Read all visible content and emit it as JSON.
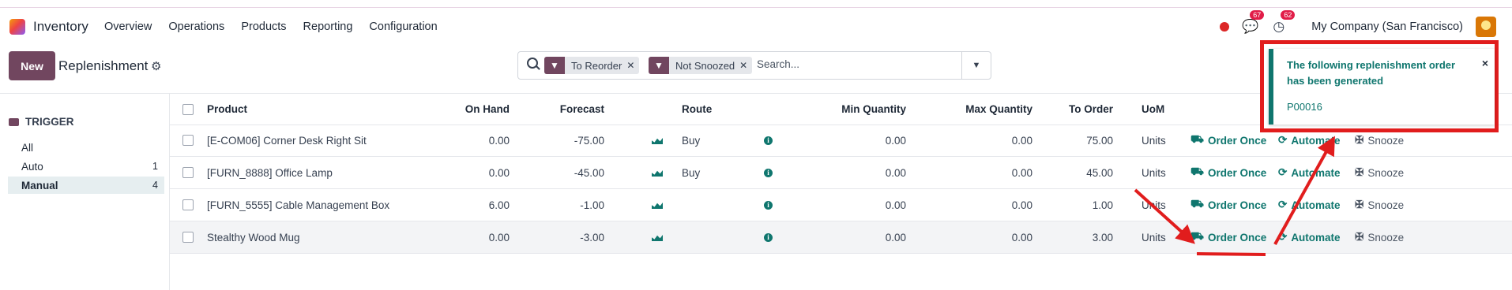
{
  "app": {
    "name": "Inventory"
  },
  "nav": {
    "menu": [
      "Overview",
      "Operations",
      "Products",
      "Reporting",
      "Configuration"
    ],
    "messages_count": "67",
    "activities_count": "62",
    "company": "My Company (San Francisco)"
  },
  "controls": {
    "new_label": "New",
    "page_title": "Replenishment"
  },
  "search": {
    "facets": [
      {
        "label": "To Reorder"
      },
      {
        "label": "Not Snoozed"
      }
    ],
    "placeholder": "Search..."
  },
  "sidepanel": {
    "title": "TRIGGER",
    "items": [
      {
        "label": "All",
        "count": ""
      },
      {
        "label": "Auto",
        "count": "1"
      },
      {
        "label": "Manual",
        "count": "4"
      }
    ]
  },
  "table": {
    "headers": {
      "product": "Product",
      "on_hand": "On Hand",
      "forecast": "Forecast",
      "route": "Route",
      "min_qty": "Min Quantity",
      "max_qty": "Max Quantity",
      "to_order": "To Order",
      "uom": "UoM"
    },
    "actions": {
      "order_once": "Order Once",
      "automate": "Automate",
      "snooze": "Snooze"
    },
    "rows": [
      {
        "product": "[E-COM06] Corner Desk Right Sit",
        "on_hand": "0.00",
        "forecast": "-75.00",
        "route": "Buy",
        "min_qty": "0.00",
        "max_qty": "0.00",
        "to_order": "75.00",
        "uom": "Units"
      },
      {
        "product": "[FURN_8888] Office Lamp",
        "on_hand": "0.00",
        "forecast": "-45.00",
        "route": "Buy",
        "min_qty": "0.00",
        "max_qty": "0.00",
        "to_order": "45.00",
        "uom": "Units"
      },
      {
        "product": "[FURN_5555] Cable Management Box",
        "on_hand": "6.00",
        "forecast": "-1.00",
        "route": "",
        "min_qty": "0.00",
        "max_qty": "0.00",
        "to_order": "1.00",
        "uom": "Units"
      },
      {
        "product": "Stealthy Wood Mug",
        "on_hand": "0.00",
        "forecast": "-3.00",
        "route": "",
        "min_qty": "0.00",
        "max_qty": "0.00",
        "to_order": "3.00",
        "uom": "Units"
      }
    ]
  },
  "notification": {
    "title": "The following replenishment order has been generated",
    "link": "P00016"
  },
  "colors": {
    "brand": "#71465f",
    "accent": "#0f766e",
    "annotation": "#e11d1d"
  }
}
